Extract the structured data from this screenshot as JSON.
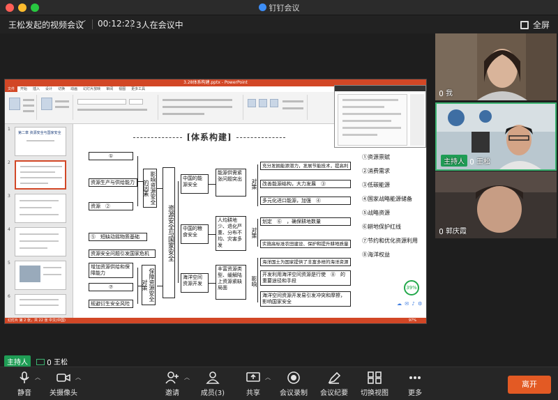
{
  "window": {
    "title": "钉钉会议"
  },
  "meeting": {
    "name": "王松发起的视频会议",
    "timer": "00:12:22",
    "participants_text": "3人在会议中",
    "fullscreen_label": "全屏"
  },
  "ppt": {
    "file_title": "3.28体系构建.pptx - PowerPoint",
    "tabs": [
      "文件",
      "开始",
      "插入",
      "设计",
      "切换",
      "动画",
      "幻灯片放映",
      "审阅",
      "视图",
      "更多工具"
    ],
    "active_tab": "开始",
    "slide_title": "[体系构建]",
    "thumb1_title": "第二章 资源安全与国家安全",
    "status": "幻灯片 第 2 张，共 22 张    中文(中国)",
    "zoom": "97%"
  },
  "diagram": {
    "blank1": "①",
    "resource_prod": "资源生产与供给能力",
    "resource_2": "资源　②",
    "factors": "影响资源安全的因素",
    "short_supply": "⑤　短缺动摇物质基础",
    "crisis": "资源安全问题引发国家危机",
    "increase": "增加资源供给和保障能力",
    "blank7": "⑦",
    "risk": "规避衍生安全风险",
    "measures": "保障资源安全对策",
    "central": "资源安全与国家安全",
    "energy": "中国的能源安全",
    "food": "中国的粮食安全",
    "ocean": "海洋空间资源开发",
    "energy_problem": "能源供需紧张问题突出",
    "land_problem": "人均耕地少、退化严重、分布不均、灾害多发",
    "ocean_problem": "丰富资源类型、缓解陆上资源紧缺局面",
    "dui": "对策",
    "ying": "影响",
    "e1": "充分发掘能源潜力，发展节能技术，提高利用率",
    "e2": "改善能源结构，大力发展　③",
    "e3": "多元化进口能源，加强　④",
    "f1": "划定　⑥　，确保耕地数量",
    "f2": "实施高标准农田建设、保护和提升耕地质量",
    "o1": "海洋国土为国家提供了丰富多样的海洋资源",
    "o2": "开发利用海洋空间资源是行使　⑧　的重要途径和手段",
    "o3": "海洋空间资源开发易引发冲突和摩擦，影响国家安全"
  },
  "answers": [
    "①资源禀赋",
    "②消费需求",
    "③低碳能源",
    "④国家战略能源储备",
    "⑤战略资源",
    "⑥耕地保护红线",
    "⑦节约和优化资源利用",
    "⑧海洋权益"
  ],
  "progress_badge": "39%",
  "participants": [
    {
      "name": "我",
      "host": false
    },
    {
      "name": "王松",
      "host": true,
      "host_label": "主持人"
    },
    {
      "name": "郭庆霞",
      "host": false
    }
  ],
  "bottom_host": {
    "badge": "主持人",
    "name": "王松"
  },
  "toolbar": {
    "mute": "静音",
    "camera": "关摄像头",
    "invite": "邀请",
    "members": "成员(3)",
    "share": "共享",
    "record": "会议录制",
    "minutes": "会议纪要",
    "switch_view": "切换视图",
    "more": "更多",
    "leave": "离开"
  },
  "colors": {
    "ppt_red": "#d24726",
    "leave": "#e35a24",
    "host_green": "#1f9d55"
  }
}
